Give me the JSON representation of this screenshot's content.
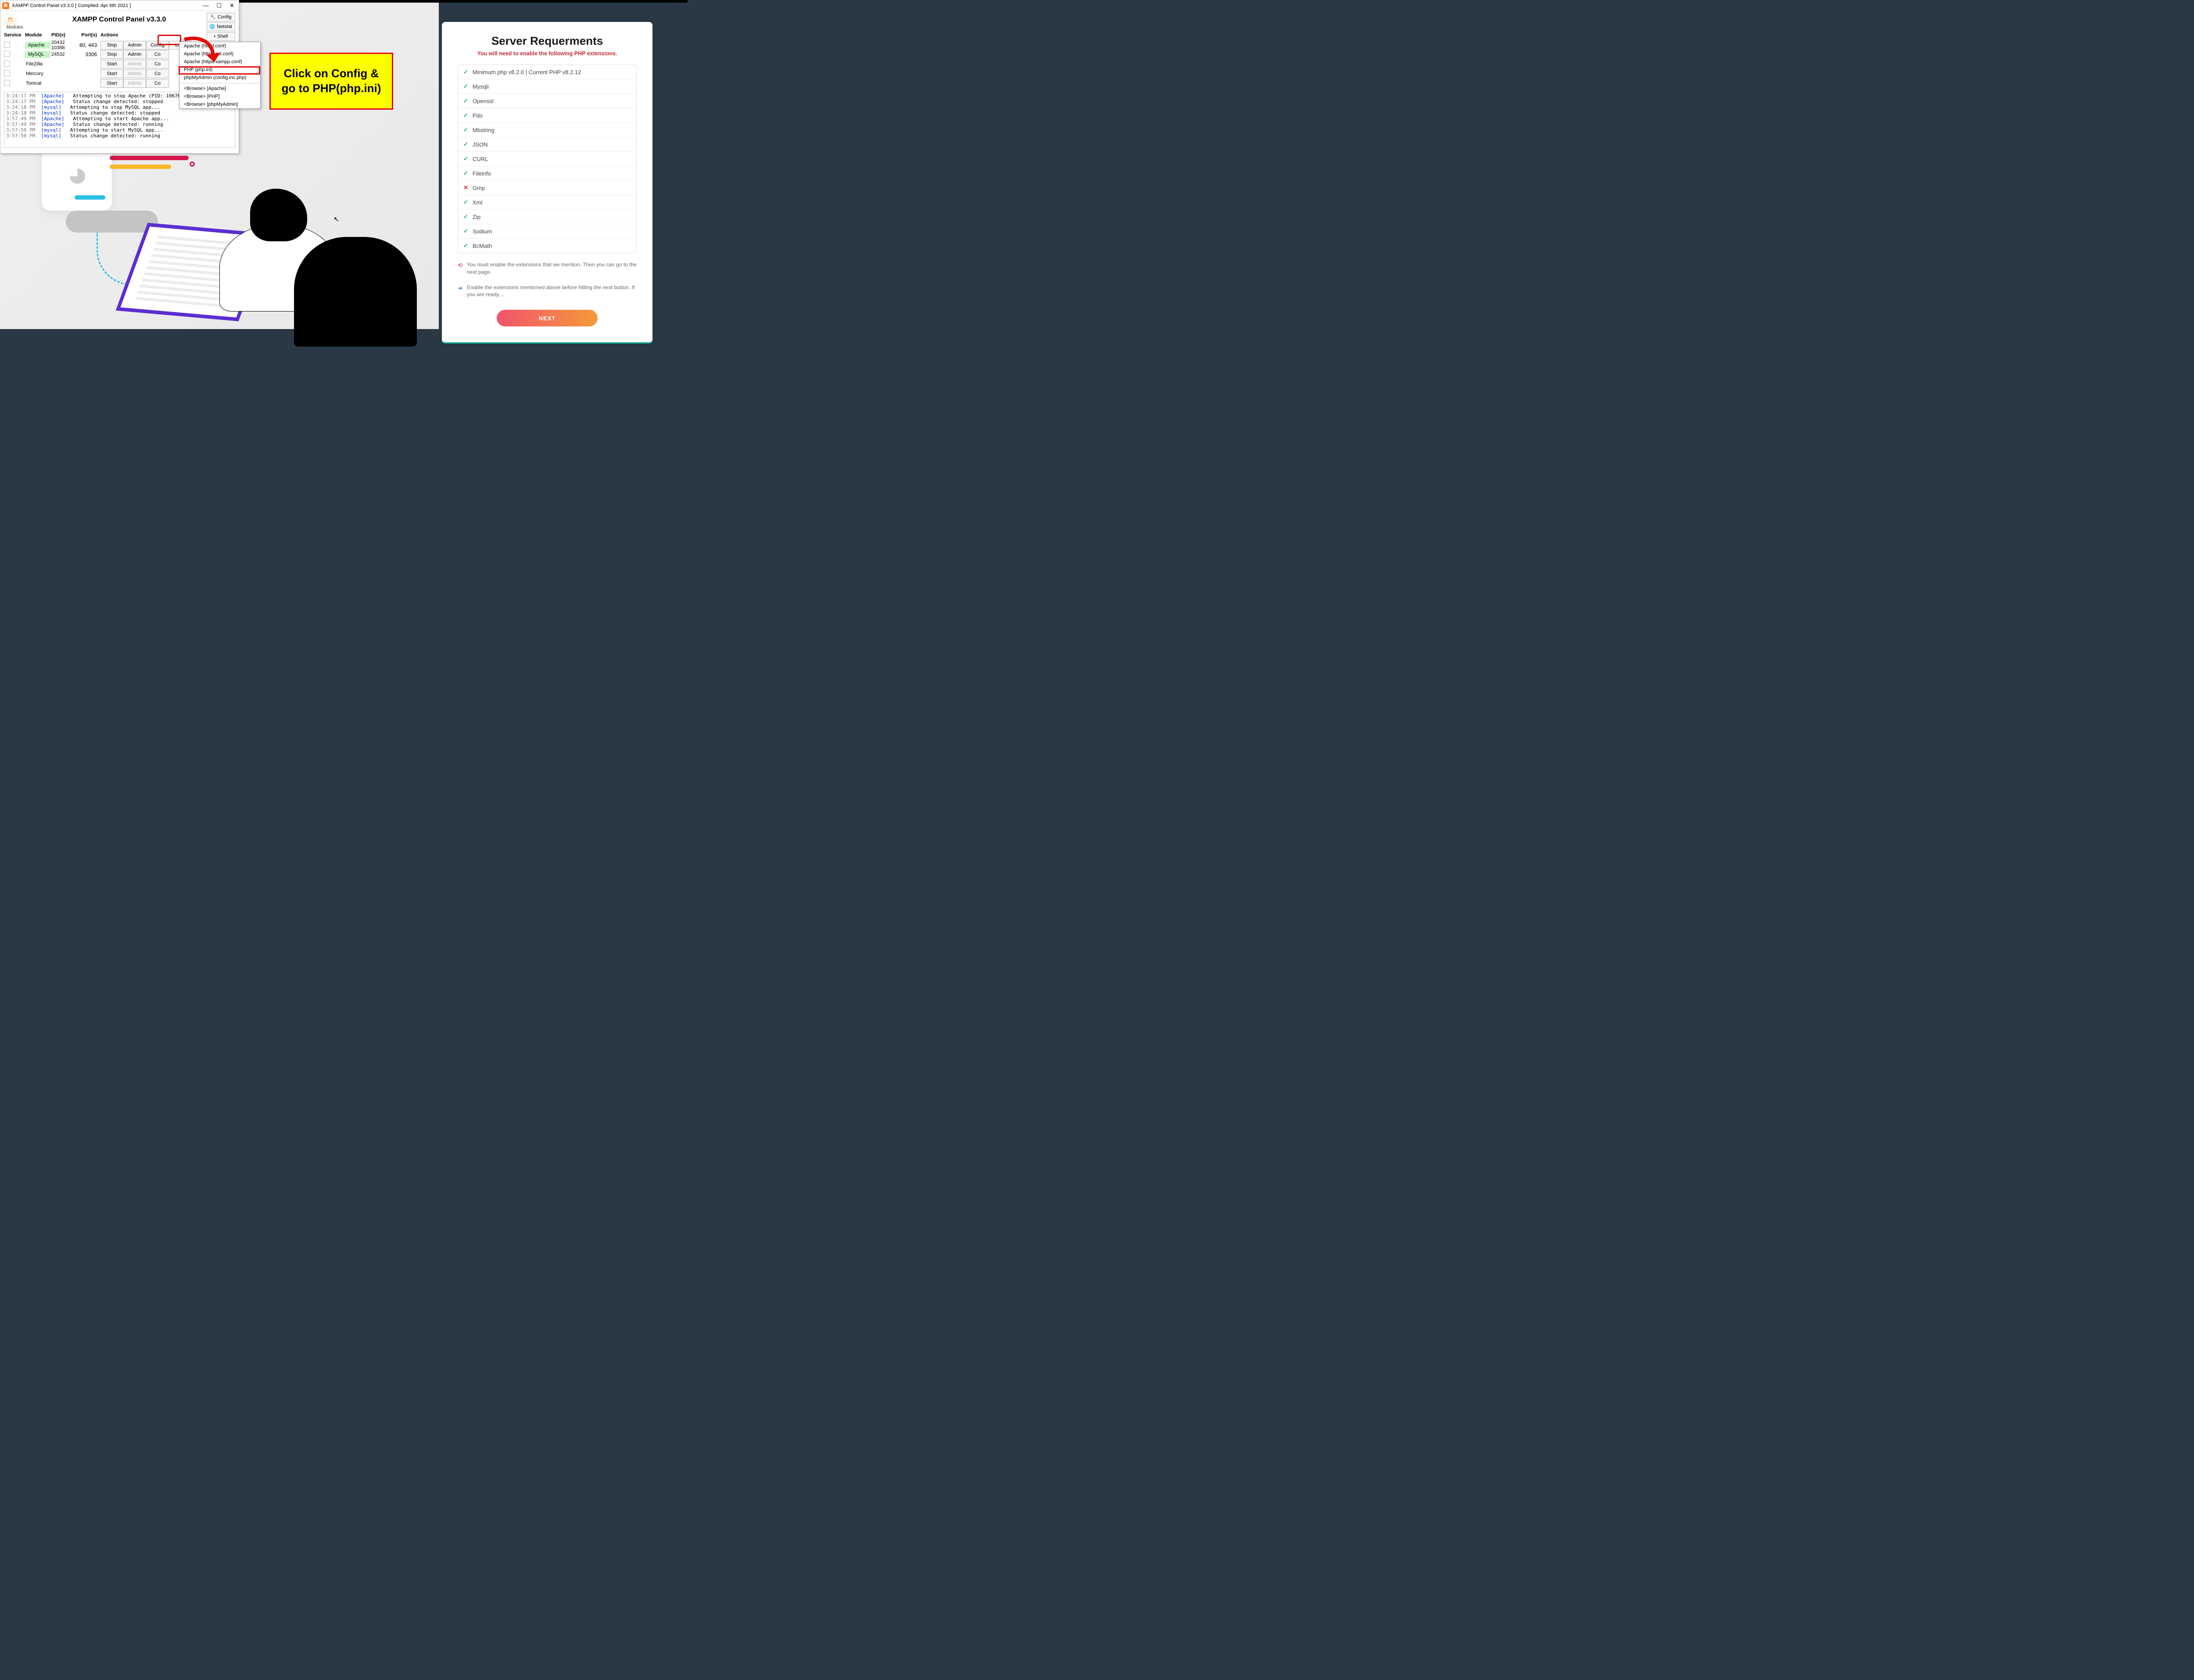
{
  "xampp": {
    "titlebar": "XAMPP Control Panel v3.3.0   [ Compiled: Apr 6th 2021 ]",
    "header": "XAMPP Control Panel v3.3.0",
    "modules_label": "Modules",
    "columns": {
      "service": "Service",
      "module": "Module",
      "pids": "PID(s)",
      "ports": "Port(s)",
      "actions": "Actions"
    },
    "side": {
      "config": "Config",
      "netstat": "Netstat",
      "shell": "Shell"
    },
    "btn": {
      "stop": "Stop",
      "start": "Start",
      "admin": "Admin",
      "config": "Config",
      "logs": "Logs",
      "co": "Co"
    },
    "rows": [
      {
        "module": "Apache",
        "pids": "20432\n10388",
        "ports": "80, 443",
        "running": true
      },
      {
        "module": "MySQL",
        "pids": "24532",
        "ports": "3306",
        "running": true
      },
      {
        "module": "FileZilla",
        "pids": "",
        "ports": "",
        "running": false
      },
      {
        "module": "Mercury",
        "pids": "",
        "ports": "",
        "running": false
      },
      {
        "module": "Tomcat",
        "pids": "",
        "ports": "",
        "running": false
      }
    ],
    "logs": [
      {
        "ts": "3:24:17 PM",
        "svc": "[Apache]",
        "msg": "Attempting to stop Apache (PID: 10676)"
      },
      {
        "ts": "3:24:17 PM",
        "svc": "[Apache]",
        "msg": "Status change detected: stopped"
      },
      {
        "ts": "3:24:18 PM",
        "svc": "[mysql]",
        "msg": "Attempting to stop MySQL app..."
      },
      {
        "ts": "3:24:18 PM",
        "svc": "[mysql]",
        "msg": "Status change detected: stopped"
      },
      {
        "ts": "3:57:49 PM",
        "svc": "[Apache]",
        "msg": "Attempting to start Apache app..."
      },
      {
        "ts": "3:57:49 PM",
        "svc": "[Apache]",
        "msg": "Status change detected: running"
      },
      {
        "ts": "3:57:50 PM",
        "svc": "[mysql]",
        "msg": "Attempting to start MySQL app..."
      },
      {
        "ts": "3:57:50 PM",
        "svc": "[mysql]",
        "msg": "Status change detected: running"
      }
    ],
    "config_menu": {
      "items_top": [
        "Apache (httpd.conf)",
        "Apache (httpd-ssl.conf)",
        "Apache (httpd-xampp.conf)",
        "PHP (php.ini)",
        "phpMyAdmin (config.inc.php)"
      ],
      "items_bottom": [
        "<Browse> [Apache]",
        "<Browse> [PHP]",
        "<Browse> [phpMyAdmin]"
      ]
    }
  },
  "callout": {
    "line1": "Click on Config &",
    "line2": "go to PHP(php.ini)"
  },
  "req": {
    "title": "Server Requerments",
    "subtitle": "You will need to enable the following PHP extensions.",
    "exts": [
      {
        "ok": true,
        "label": "Minimum php v8.2.0 | Current PHP v8.2.12"
      },
      {
        "ok": true,
        "label": "Mysqli"
      },
      {
        "ok": true,
        "label": "Openssl"
      },
      {
        "ok": true,
        "label": "Pdo"
      },
      {
        "ok": true,
        "label": "Mbstring"
      },
      {
        "ok": true,
        "label": "JSON"
      },
      {
        "ok": true,
        "label": "CURL"
      },
      {
        "ok": true,
        "label": "Fileinfo"
      },
      {
        "ok": false,
        "label": "Gmp"
      },
      {
        "ok": true,
        "label": "Xml"
      },
      {
        "ok": true,
        "label": "Zip"
      },
      {
        "ok": true,
        "label": "Sodium"
      },
      {
        "ok": true,
        "label": "BcMath"
      }
    ],
    "note1": "You must enable the extensions that we mention. Then you can go to the next page.",
    "note2": "Enable the extensions mentioned above before hitting the next button. If you are ready....",
    "next": "NEXT"
  }
}
